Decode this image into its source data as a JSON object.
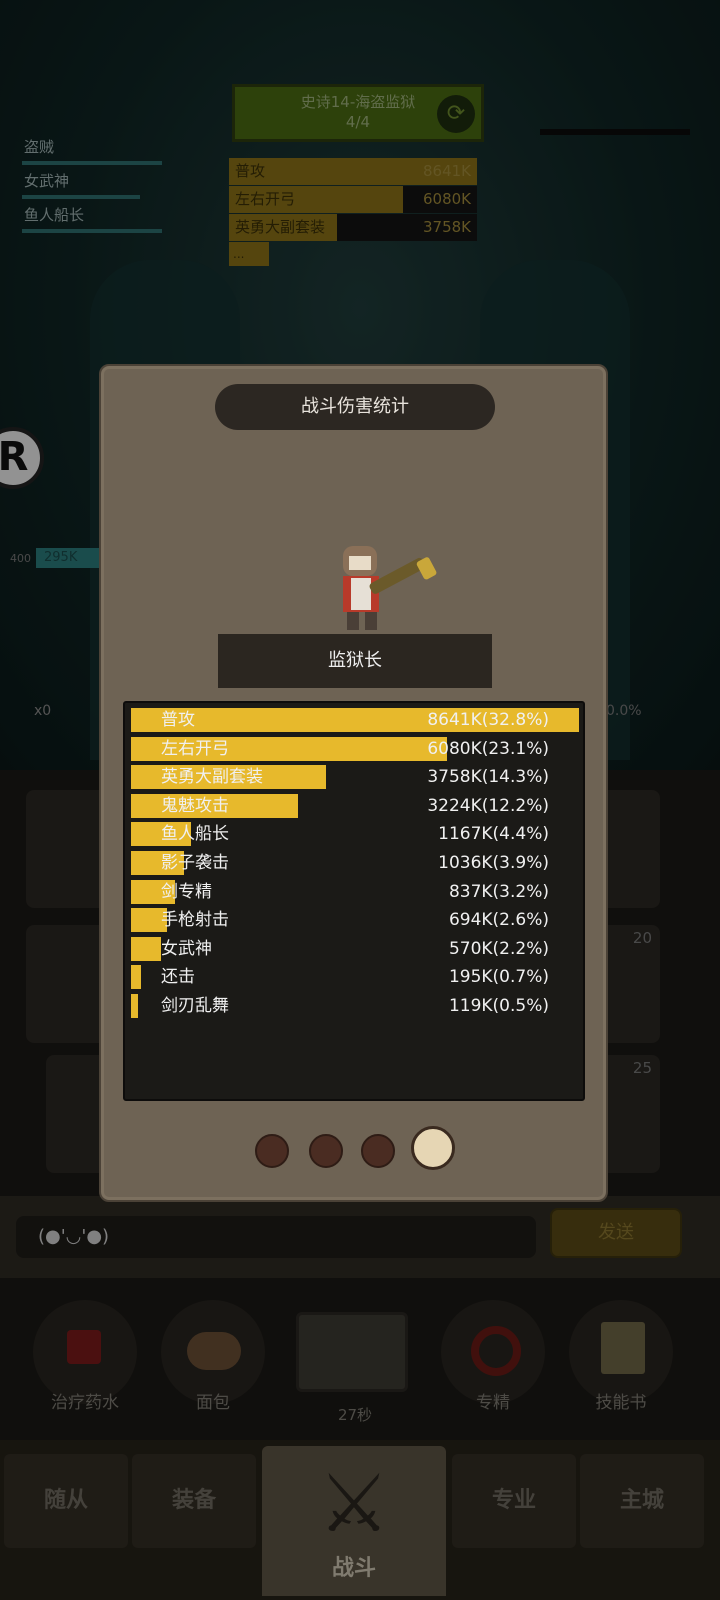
{
  "header": {
    "stage_title": "史诗14-海盗监狱",
    "stage_progress": "4/4",
    "refresh_icon": "refresh-icon"
  },
  "left_list": [
    "盗贼",
    "女武神",
    "鱼人船长"
  ],
  "mini_stats": [
    {
      "name": "普攻",
      "value": "8641K"
    },
    {
      "name": "左右开弓",
      "value": "6080K"
    },
    {
      "name": "英勇大副套装",
      "value": "3758K"
    }
  ],
  "mini_more": "...",
  "side": {
    "badge_letter": "R",
    "hp_small": "400",
    "hp_value": "295K",
    "multiplier": "x0",
    "pct": "0.0%"
  },
  "slots": {
    "num_a": "20",
    "num_b": "25"
  },
  "chat": {
    "input_value": "(●'◡'●)",
    "send_label": "发送"
  },
  "quick_items": [
    {
      "label": "治疗药水",
      "icon": "potion-icon"
    },
    {
      "label": "面包",
      "icon": "bread-icon"
    },
    {
      "label": "27秒",
      "icon": "chest-icon"
    },
    {
      "label": "专精",
      "icon": "target-icon"
    },
    {
      "label": "技能书",
      "icon": "skillbook-icon"
    }
  ],
  "nav": {
    "followers": "随从",
    "equipment": "装备",
    "battle": "战斗",
    "profession": "专业",
    "main_city": "主城"
  },
  "modal": {
    "title": "战斗伤害统计",
    "boss_name": "监狱长",
    "page_count": 4,
    "active_page": 4
  },
  "chart_data": {
    "type": "bar",
    "title": "战斗伤害统计",
    "categories": [
      "普攻",
      "左右开弓",
      "英勇大副套装",
      "鬼魅攻击",
      "鱼人船长",
      "影子袭击",
      "剑专精",
      "手枪射击",
      "女武神",
      "还击",
      "剑刃乱舞"
    ],
    "values_k": [
      8641,
      6080,
      3758,
      3224,
      1167,
      1036,
      837,
      694,
      570,
      195,
      119
    ],
    "percent": [
      32.8,
      23.1,
      14.3,
      12.2,
      4.4,
      3.9,
      3.2,
      2.6,
      2.2,
      0.7,
      0.5
    ],
    "labels": [
      "8641K(32.8%)",
      "6080K(23.1%)",
      "3758K(14.3%)",
      "3224K(12.2%)",
      "1167K(4.4%)",
      "1036K(3.9%)",
      "837K(3.2%)",
      "694K(2.6%)",
      "570K(2.2%)",
      "195K(0.7%)",
      "119K(0.5%)"
    ],
    "bar_color": "#e7b92c"
  }
}
